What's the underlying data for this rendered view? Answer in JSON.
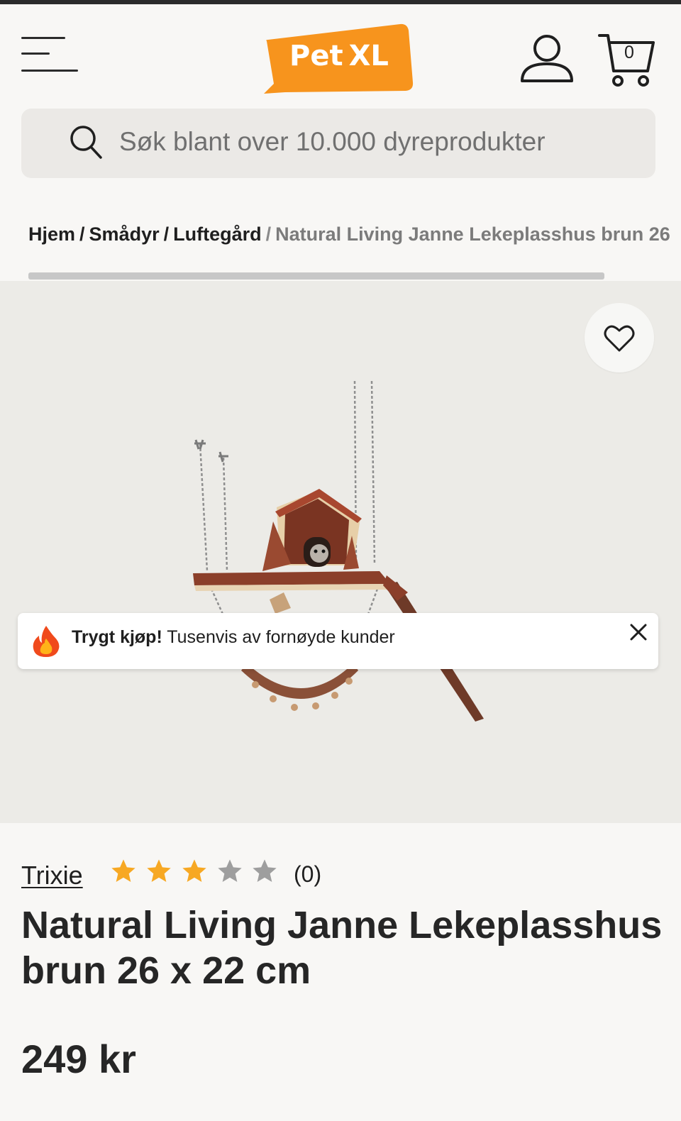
{
  "header": {
    "menu_icon": "hamburger-icon",
    "logo": {
      "text_pet": "Pet",
      "text_xl": "XL",
      "color": "#f7941d"
    },
    "account_icon": "user-icon",
    "cart": {
      "icon": "cart-icon",
      "count": "0"
    }
  },
  "search": {
    "icon": "search-icon",
    "placeholder": "Søk blant over 10.000 dyreprodukter",
    "value": ""
  },
  "breadcrumb": {
    "items": [
      "Hjem",
      "Smådyr",
      "Luftegård"
    ],
    "separator": "/",
    "current": "Natural Living Janne Lekeplasshus brun 26"
  },
  "gallery": {
    "favorite_icon": "heart-icon",
    "background": "#ecebe7"
  },
  "notice": {
    "icon": "fire-icon",
    "bold": "Trygt kjøp!",
    "text": "Tusenvis av fornøyde kunder",
    "close_icon": "close-icon"
  },
  "product": {
    "brand": "Trixie",
    "rating": 3,
    "rating_max": 5,
    "review_count": "(0)",
    "title": "Natural Living Janne Lekeplasshus brun 26 x 22 cm",
    "price": "249 kr"
  },
  "colors": {
    "accent": "#f7941d",
    "star_filled": "#f7a823",
    "star_empty": "#9e9e9e",
    "text": "#262626"
  }
}
